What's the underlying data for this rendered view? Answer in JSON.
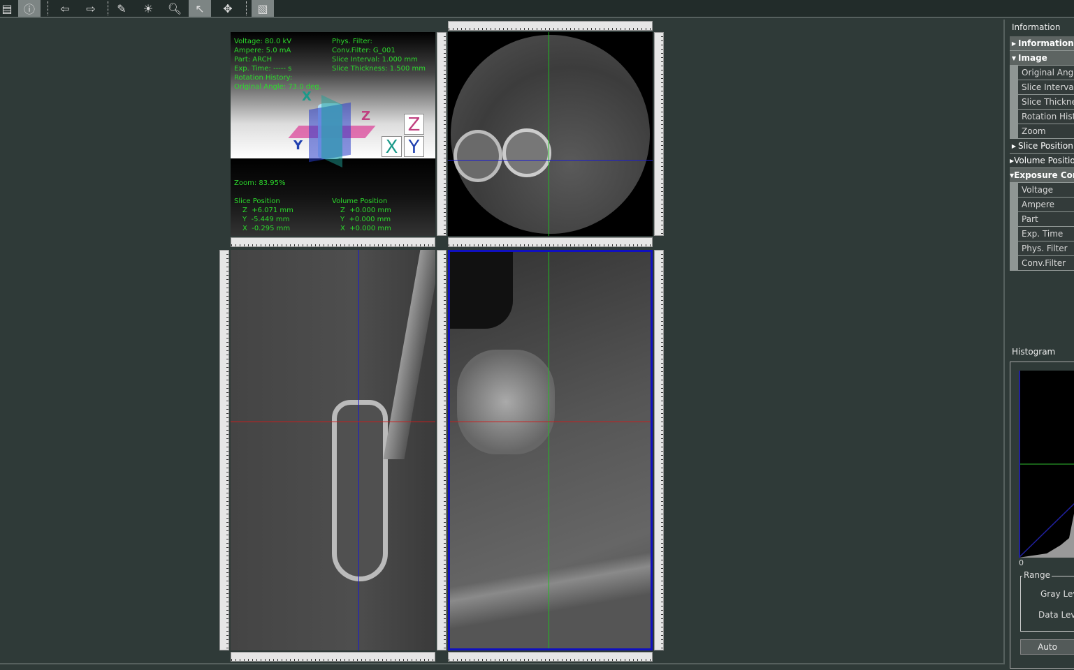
{
  "toolbar": {
    "buttons": [
      "save-icon",
      "info-icon",
      "back-arrow-icon",
      "forward-arrow-icon",
      "eraser-icon",
      "brightness-icon",
      "zoom-icon",
      "pointer-icon",
      "pan-icon",
      "layout-icon"
    ]
  },
  "overlay": {
    "left": [
      "Voltage: 80.0 kV",
      "Ampere: 5.0 mA",
      "Part: ARCH",
      "Exp. Time: ----- s",
      "Rotation History:",
      "Original Angle: 73.0 deg."
    ],
    "right": [
      "Phys. Filter:",
      "Conv.Filter: G_001",
      "Slice Interval: 1.000 mm",
      "Slice Thickness: 1.500 mm"
    ],
    "zoom": "Zoom: 83.95%",
    "slice_title": "Slice Position",
    "slice": [
      "Z  +6.071 mm",
      "Y  -5.449 mm",
      "X  -0.295 mm"
    ],
    "volume_title": "Volume Position",
    "volume": [
      "Z  +0.000 mm",
      "Y  +0.000 mm",
      "X  +0.000 mm"
    ],
    "axes": {
      "x": "X",
      "y": "Y",
      "z": "Z"
    }
  },
  "colors": {
    "overlay_text": "#2cd92c",
    "crosshair_green": "#1fc01f",
    "crosshair_blue": "#1a1ad0",
    "crosshair_red": "#d01a1a",
    "active_border": "#1010c0"
  },
  "right_panel": {
    "info_title": "Information",
    "tree": [
      {
        "type": "grp",
        "toggle": "▶",
        "label": "Information"
      },
      {
        "type": "grp",
        "toggle": "▼",
        "label": "Image"
      },
      {
        "type": "leaf",
        "label": "Original Angle"
      },
      {
        "type": "leaf",
        "label": "Slice Interval"
      },
      {
        "type": "leaf",
        "label": "Slice Thickness"
      },
      {
        "type": "leaf",
        "label": "Rotation History"
      },
      {
        "type": "leaf",
        "label": "Zoom"
      },
      {
        "type": "grp2",
        "toggle": "▶",
        "label": "Slice Position"
      },
      {
        "type": "grp2",
        "toggle": "▶",
        "label": "Volume Position"
      },
      {
        "type": "grp",
        "toggle": "▼",
        "label": "Exposure Condition"
      },
      {
        "type": "leaf",
        "label": "Voltage"
      },
      {
        "type": "leaf",
        "label": "Ampere"
      },
      {
        "type": "leaf",
        "label": "Part"
      },
      {
        "type": "leaf",
        "label": "Exp. Time"
      },
      {
        "type": "leaf",
        "label": "Phys. Filter"
      },
      {
        "type": "leaf",
        "label": "Conv.Filter"
      }
    ],
    "histogram_title": "Histogram",
    "hist_zero": "0",
    "range_label": "Range",
    "gray_level": "Gray Level",
    "data_level": "Data Level",
    "auto_button": "Auto"
  }
}
